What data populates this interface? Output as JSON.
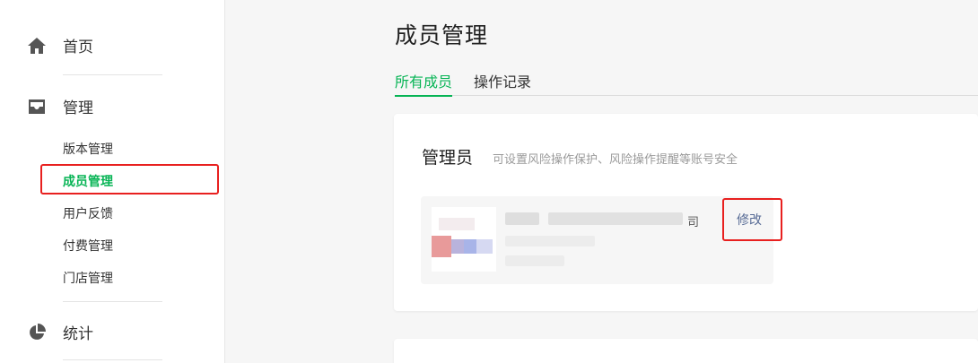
{
  "sidebar": {
    "home": {
      "label": "首页",
      "icon": "home-icon"
    },
    "manage": {
      "label": "管理",
      "icon": "inbox-icon",
      "items": [
        {
          "label": "版本管理",
          "active": false
        },
        {
          "label": "成员管理",
          "active": true
        },
        {
          "label": "用户反馈",
          "active": false
        },
        {
          "label": "付费管理",
          "active": false
        },
        {
          "label": "门店管理",
          "active": false
        }
      ]
    },
    "stats": {
      "label": "统计",
      "icon": "pie-chart-icon"
    }
  },
  "main": {
    "title": "成员管理",
    "tabs": [
      {
        "label": "所有成员",
        "active": true
      },
      {
        "label": "操作记录",
        "active": false
      }
    ],
    "admin_section": {
      "title": "管理员",
      "description": "可设置风险操作保护、风险操作提醒等账号安全",
      "admin_name_suffix": "司",
      "edit_label": "修改"
    }
  },
  "colors": {
    "accent_green": "#07b455",
    "link_blue": "#576b95",
    "highlight_red": "#e8201f"
  }
}
